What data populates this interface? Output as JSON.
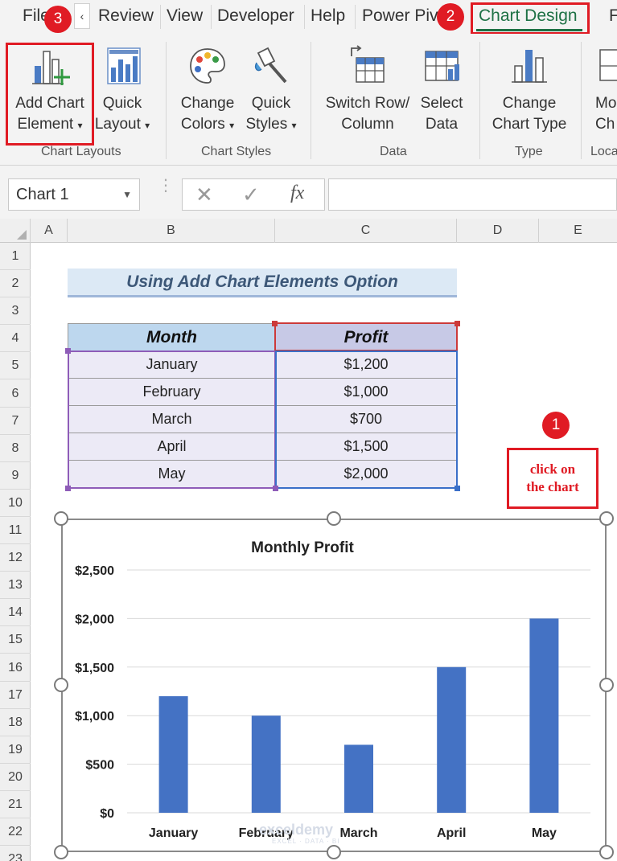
{
  "ribbon_tabs": {
    "file": "File",
    "review": "Review",
    "view": "View",
    "developer": "Developer",
    "help": "Help",
    "power_pivot": "Power Piv",
    "chart_design": "Chart Design",
    "format": "F",
    "scroll_left": "‹"
  },
  "badges": {
    "one": "1",
    "two": "2",
    "three": "3"
  },
  "ribbon": {
    "add_chart_element": {
      "line1": "Add Chart",
      "line2": "Element"
    },
    "quick_layout": {
      "line1": "Quick",
      "line2": "Layout"
    },
    "change_colors": {
      "line1": "Change",
      "line2": "Colors"
    },
    "quick_styles": {
      "line1": "Quick",
      "line2": "Styles"
    },
    "switch_row_column": {
      "line1": "Switch Row/",
      "line2": "Column"
    },
    "select_data": {
      "line1": "Select",
      "line2": "Data"
    },
    "change_chart_type": {
      "line1": "Change",
      "line2": "Chart Type"
    },
    "move_chart": {
      "line1": "Mo",
      "line2": "Ch"
    },
    "groups": {
      "chart_layouts": "Chart Layouts",
      "chart_styles": "Chart Styles",
      "data": "Data",
      "type": "Type",
      "location": "Loca"
    }
  },
  "formula_bar": {
    "name_box": "Chart 1",
    "cancel": "✕",
    "enter": "✓",
    "fx": "fx"
  },
  "columns": [
    "A",
    "B",
    "C",
    "D",
    "E"
  ],
  "rows": [
    "1",
    "2",
    "3",
    "4",
    "5",
    "6",
    "7",
    "8",
    "9",
    "10",
    "11",
    "12",
    "13",
    "14",
    "15",
    "16",
    "17",
    "18",
    "19",
    "20",
    "21",
    "22",
    "23"
  ],
  "sheet": {
    "title": "Using Add Chart Elements Option",
    "headers": {
      "month": "Month",
      "profit": "Profit"
    },
    "rows": [
      {
        "month": "January",
        "profit": "$1,200"
      },
      {
        "month": "February",
        "profit": "$1,000"
      },
      {
        "month": "March",
        "profit": "$700"
      },
      {
        "month": "April",
        "profit": "$1,500"
      },
      {
        "month": "May",
        "profit": "$2,000"
      }
    ],
    "note": {
      "line1": "click on",
      "line2": "the chart"
    }
  },
  "watermark": {
    "text": "exceldemy",
    "sub": "EXCEL · DATA · BI"
  },
  "colors": {
    "accent_green": "#1e7145",
    "annotation_red": "#e01b24",
    "bar_blue": "#4472c4"
  },
  "chart_data": {
    "type": "bar",
    "title": "Monthly Profit",
    "categories": [
      "January",
      "February",
      "March",
      "April",
      "May"
    ],
    "values": [
      1200,
      1000,
      700,
      1500,
      2000
    ],
    "ylim": [
      0,
      2500
    ],
    "yticks": [
      0,
      500,
      1000,
      1500,
      2000,
      2500
    ],
    "ytick_labels": [
      "$0",
      "$500",
      "$1,000",
      "$1,500",
      "$2,000",
      "$2,500"
    ],
    "grid": true,
    "legend": "none",
    "color": "#4472c4"
  }
}
